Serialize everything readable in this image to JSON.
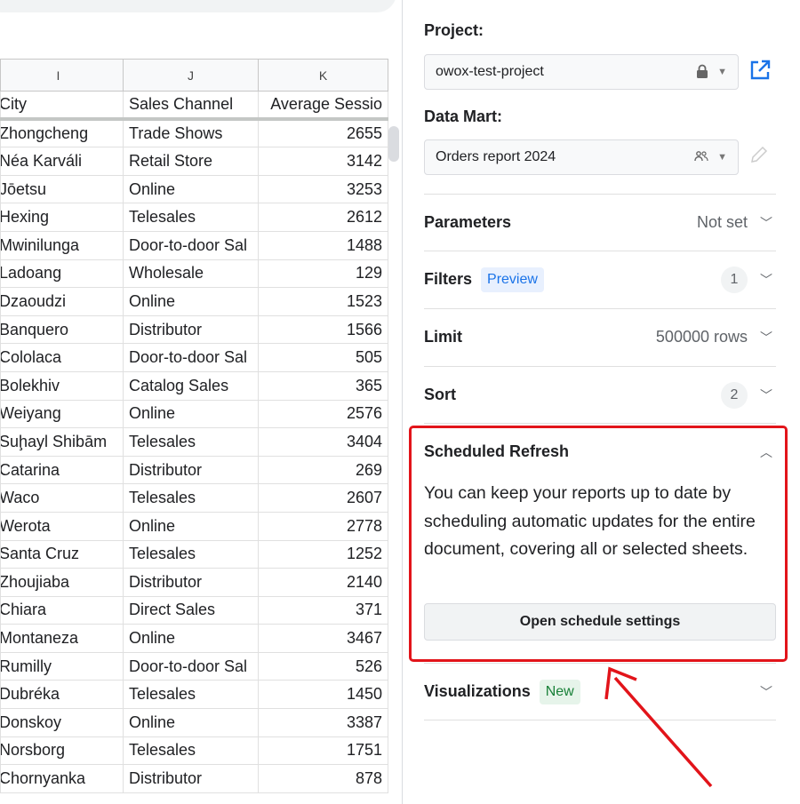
{
  "sheet": {
    "columns": [
      "I",
      "J",
      "K"
    ],
    "header": [
      "City",
      "Sales Channel",
      "Average Sessio"
    ],
    "rows": [
      [
        "Zhongcheng",
        "Trade Shows",
        "2655"
      ],
      [
        "Néa Karváli",
        "Retail Store",
        "3142"
      ],
      [
        "Jōetsu",
        "Online",
        "3253"
      ],
      [
        "Hexing",
        "Telesales",
        "2612"
      ],
      [
        "Mwinilunga",
        "Door-to-door Sal",
        "1488"
      ],
      [
        "Ladoang",
        "Wholesale",
        "129"
      ],
      [
        "Dzaoudzi",
        "Online",
        "1523"
      ],
      [
        "Banquero",
        "Distributor",
        "1566"
      ],
      [
        "Cololaca",
        "Door-to-door Sal",
        "505"
      ],
      [
        "Bolekhiv",
        "Catalog Sales",
        "365"
      ],
      [
        "Weiyang",
        "Online",
        "2576"
      ],
      [
        "Suḩayl Shibām",
        "Telesales",
        "3404"
      ],
      [
        "Catarina",
        "Distributor",
        "269"
      ],
      [
        "Waco",
        "Telesales",
        "2607"
      ],
      [
        "Werota",
        "Online",
        "2778"
      ],
      [
        "Santa Cruz",
        "Telesales",
        "1252"
      ],
      [
        "Zhoujiaba",
        "Distributor",
        "2140"
      ],
      [
        "Chiara",
        "Direct Sales",
        "371"
      ],
      [
        "Montaneza",
        "Online",
        "3467"
      ],
      [
        "Rumilly",
        "Door-to-door Sal",
        "526"
      ],
      [
        "Dubréka",
        "Telesales",
        "1450"
      ],
      [
        "Donskoy",
        "Online",
        "3387"
      ],
      [
        "Norsborg",
        "Telesales",
        "1751"
      ],
      [
        "Chornyanka",
        "Distributor",
        "878"
      ]
    ]
  },
  "panel": {
    "project_label": "Project:",
    "project_value": "owox-test-project",
    "datamart_label": "Data Mart:",
    "datamart_value": "Orders report 2024",
    "parameters": {
      "title": "Parameters",
      "value": "Not set"
    },
    "filters": {
      "title": "Filters",
      "tag": "Preview",
      "count": "1"
    },
    "limit": {
      "title": "Limit",
      "value": "500000 rows"
    },
    "sort": {
      "title": "Sort",
      "count": "2"
    },
    "scheduled": {
      "title": "Scheduled Refresh",
      "body": "You can keep your reports up to date by scheduling automatic updates for the entire document, covering all or selected sheets.",
      "button": "Open schedule settings"
    },
    "visualizations": {
      "title": "Visualizations",
      "tag": "New"
    }
  },
  "colors": {
    "accent": "#1a73e8",
    "highlight": "#e2141a",
    "new_tag": "#188038"
  },
  "icons": [
    "lock-icon",
    "external-link-icon",
    "people-icon",
    "pencil-icon",
    "chevron-down-icon",
    "chevron-up-icon"
  ]
}
